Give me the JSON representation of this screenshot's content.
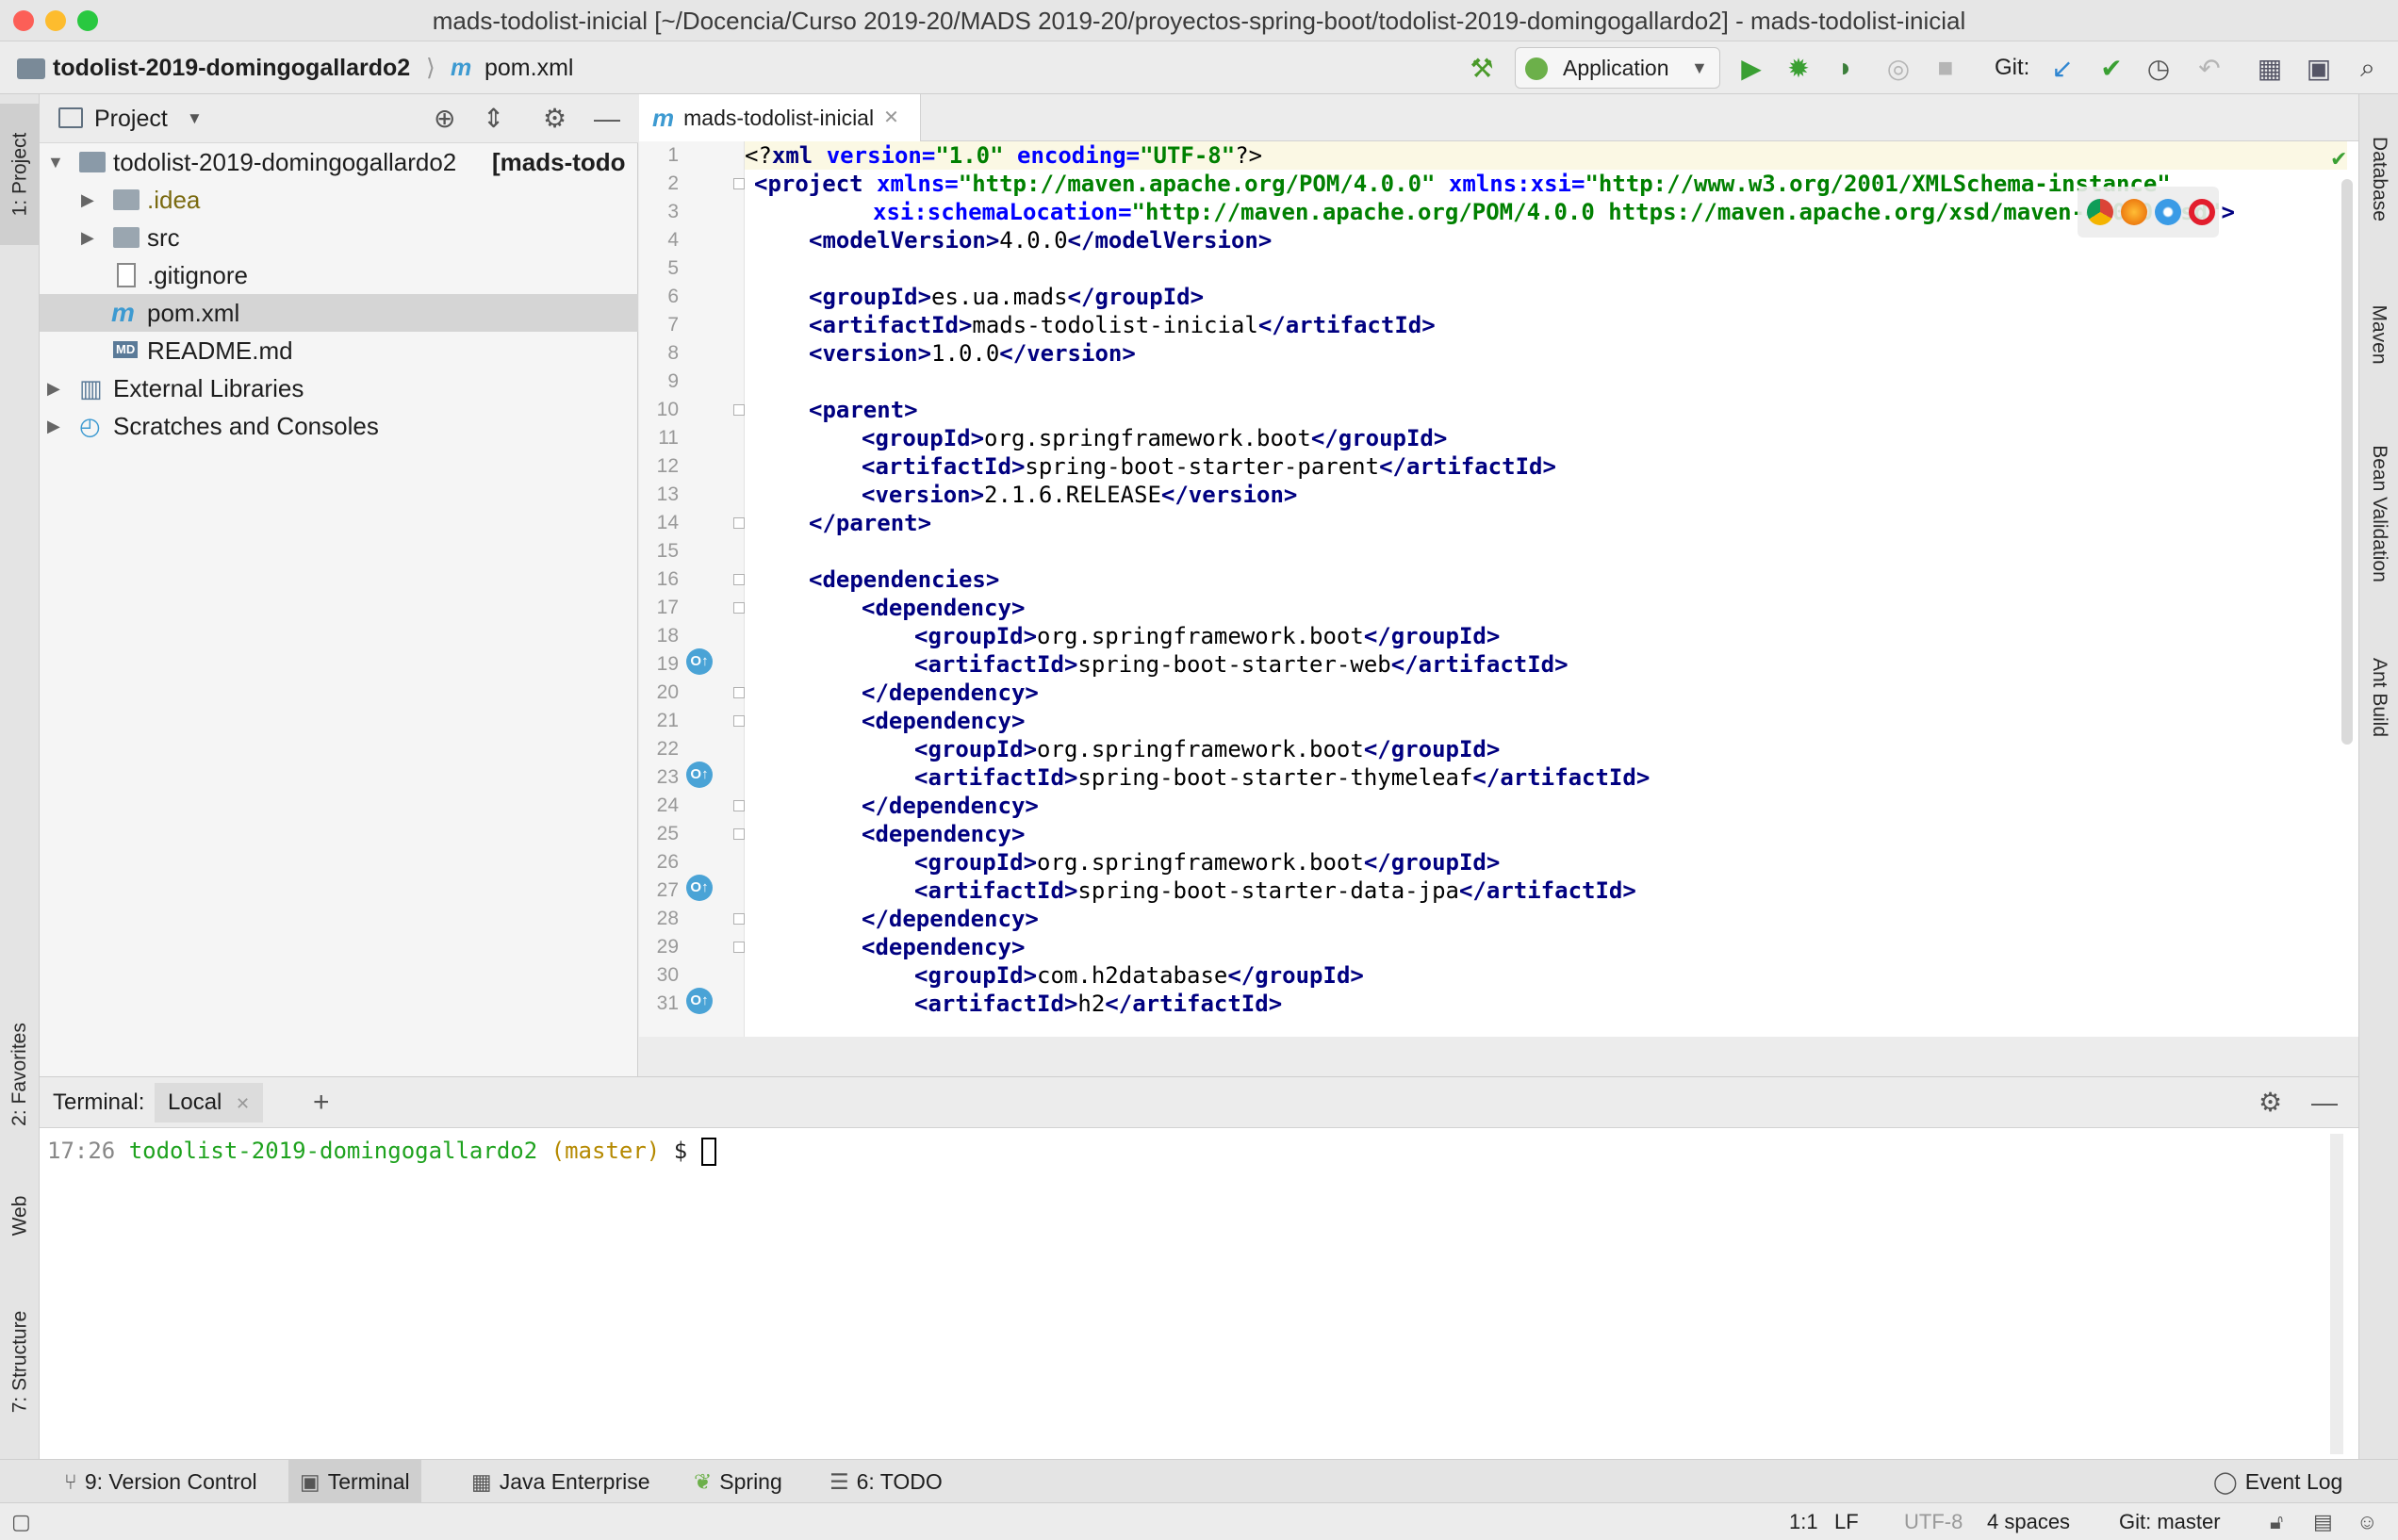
{
  "window": {
    "title": "mads-todolist-inicial [~/Docencia/Curso 2019-20/MADS 2019-20/proyectos-spring-boot/todolist-2019-domingogallardo2] - mads-todolist-inicial"
  },
  "navbar": {
    "breadcrumb_project": "todolist-2019-domingogallardo2",
    "breadcrumb_file": "pom.xml",
    "run_config": "Application",
    "git_label": "Git:"
  },
  "left_tabs": {
    "project": "1: Project",
    "favorites": "2: Favorites",
    "web": "Web",
    "structure": "7: Structure"
  },
  "right_tabs": {
    "database": "Database",
    "maven": "Maven",
    "bean_validation": "Bean Validation",
    "ant_build": "Ant Build"
  },
  "project_panel": {
    "title": "Project",
    "root_name": "todolist-2019-domingogallardo2",
    "root_module": "[mads-todo",
    "items": [
      {
        "label": ".idea"
      },
      {
        "label": "src"
      },
      {
        "label": ".gitignore"
      },
      {
        "label": "pom.xml"
      },
      {
        "label": "README.md"
      },
      {
        "label": "External Libraries"
      },
      {
        "label": "Scratches and Consoles"
      }
    ]
  },
  "editor": {
    "tab_label": "mads-todolist-inicial",
    "lines": [
      "1",
      "2",
      "3",
      "4",
      "5",
      "6",
      "7",
      "8",
      "9",
      "10",
      "11",
      "12",
      "13",
      "14",
      "15",
      "16",
      "17",
      "18",
      "19",
      "20",
      "21",
      "22",
      "23",
      "24",
      "25",
      "26",
      "27",
      "28",
      "29",
      "30",
      "31"
    ],
    "code": {
      "l1_a": "<?",
      "l1_b": "xml",
      "l1_c": " version=",
      "l1_d": "\"1.0\"",
      "l1_e": " encoding=",
      "l1_f": "\"UTF-8\"",
      "l1_g": "?>",
      "l2_tag": "<project",
      "l2_attr1": " xmlns=",
      "l2_val1": "\"http://maven.apache.org/POM/4.0.0\"",
      "l2_attr2": " xmlns:xsi=",
      "l2_val2": "\"http://www.w3.org/2001/XMLSchema-instance\"",
      "l3_attr": "xsi:schemaLocation=",
      "l3_val": "\"http://maven.apache.org/POM/4.0.0 https://maven.apache.org/xsd/maven-4.0.0.xsd\"",
      "l3_end": ">",
      "l4": [
        "<modelVersion>",
        "4.0.0",
        "</modelVersion>"
      ],
      "l6": [
        "<groupId>",
        "es.ua.mads",
        "</groupId>"
      ],
      "l7": [
        "<artifactId>",
        "mads-todolist-inicial",
        "</artifactId>"
      ],
      "l8": [
        "<version>",
        "1.0.0",
        "</version>"
      ],
      "l10": "<parent>",
      "l11": [
        "<groupId>",
        "org.springframework.boot",
        "</groupId>"
      ],
      "l12": [
        "<artifactId>",
        "spring-boot-starter-parent",
        "</artifactId>"
      ],
      "l13": [
        "<version>",
        "2.1.6.RELEASE",
        "</version>"
      ],
      "l14": "</parent>",
      "l16": "<dependencies>",
      "dep_open": "<dependency>",
      "dep_close": "</dependency>",
      "l18": [
        "<groupId>",
        "org.springframework.boot",
        "</groupId>"
      ],
      "l19": [
        "<artifactId>",
        "spring-boot-starter-web",
        "</artifactId>"
      ],
      "l22": [
        "<groupId>",
        "org.springframework.boot",
        "</groupId>"
      ],
      "l23": [
        "<artifactId>",
        "spring-boot-starter-thymeleaf",
        "</artifactId>"
      ],
      "l26": [
        "<groupId>",
        "org.springframework.boot",
        "</groupId>"
      ],
      "l27": [
        "<artifactId>",
        "spring-boot-starter-data-jpa",
        "</artifactId>"
      ],
      "l30": [
        "<groupId>",
        "com.h2database",
        "</groupId>"
      ],
      "l31": [
        "<artifactId>",
        "h2",
        "</artifactId>"
      ]
    }
  },
  "terminal": {
    "label": "Terminal:",
    "tab": "Local",
    "time": "17:26",
    "dir": "todolist-2019-domingogallardo2",
    "branch": "(master)",
    "prompt": "$"
  },
  "bottom_tools": {
    "version_control": "9: Version Control",
    "terminal": "Terminal",
    "java_enterprise": "Java Enterprise",
    "spring": "Spring",
    "todo": "6: TODO",
    "event_log": "Event Log"
  },
  "status": {
    "position": "1:1",
    "line_sep": "LF",
    "encoding": "UTF-8",
    "indent": "4 spaces",
    "git": "Git: master"
  },
  "colors": {
    "selection": "#d5d5d5",
    "terminal_green": "#1ea21e",
    "terminal_branch": "#b58900",
    "xml_tag": "#000080",
    "xml_value": "#008000",
    "xml_attr": "#0000ff"
  }
}
